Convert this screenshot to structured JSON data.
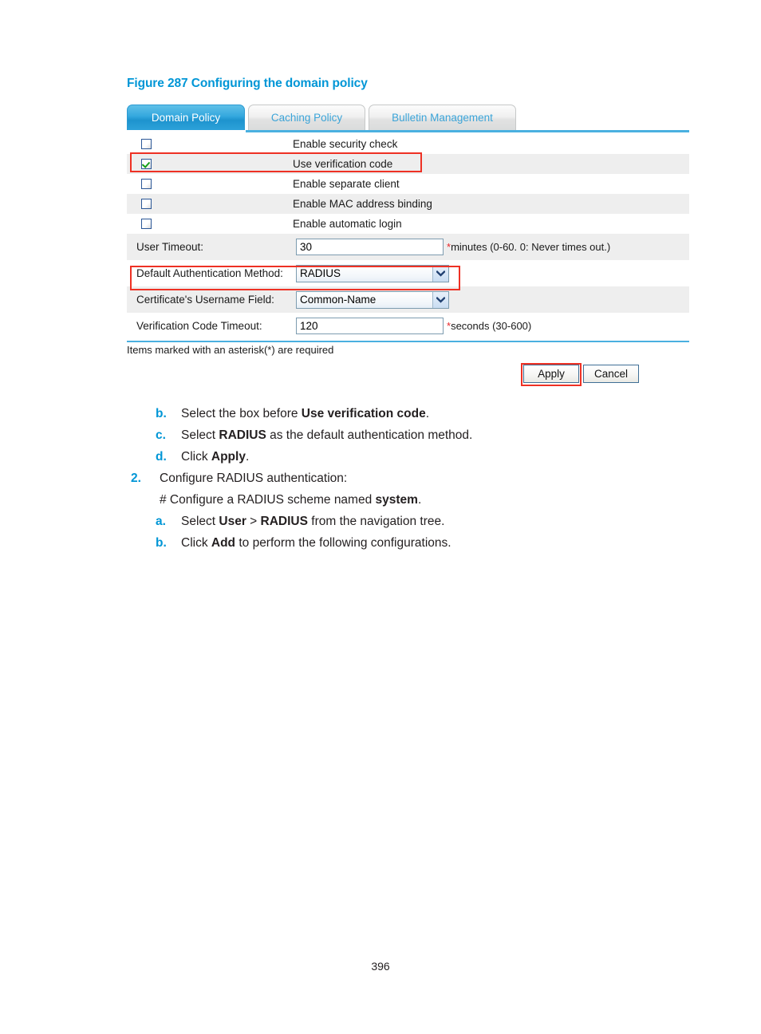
{
  "figure": {
    "caption": "Figure 287 Configuring the domain policy"
  },
  "screenshot": {
    "tabs": [
      {
        "label": "Domain Policy",
        "active": true
      },
      {
        "label": "Caching Policy",
        "active": false
      },
      {
        "label": "Bulletin Management",
        "active": false
      }
    ],
    "checkbox_rows": [
      {
        "label": "Enable security check",
        "checked": false
      },
      {
        "label": "Use verification code",
        "checked": true
      },
      {
        "label": "Enable separate client",
        "checked": false
      },
      {
        "label": "Enable MAC address binding",
        "checked": false
      },
      {
        "label": "Enable automatic login",
        "checked": false
      }
    ],
    "fields": {
      "user_timeout": {
        "label": "User Timeout:",
        "value": "30",
        "star": "*",
        "hint": "minutes (0-60. 0: Never times out.)"
      },
      "default_auth_method": {
        "label": "Default Authentication Method:",
        "value": "RADIUS"
      },
      "certificate_username_field": {
        "label": "Certificate's Username Field:",
        "value": "Common-Name"
      },
      "verification_code_timeout": {
        "label": "Verification Code Timeout:",
        "value": "120",
        "star": "*",
        "hint": "seconds (30-600)"
      }
    },
    "required_note": "Items marked with an asterisk(*) are required",
    "buttons": {
      "apply": "Apply",
      "cancel": "Cancel"
    },
    "accent_color": "#4ab0e0",
    "highlight_color": "#ee3124"
  },
  "steps": [
    {
      "marker": "b.",
      "marker_kind": "alpha",
      "parts": [
        {
          "t": "Select the box before ",
          "b": false
        },
        {
          "t": "Use verification code",
          "b": true
        },
        {
          "t": ".",
          "b": false
        }
      ]
    },
    {
      "marker": "c.",
      "marker_kind": "alpha",
      "parts": [
        {
          "t": "Select ",
          "b": false
        },
        {
          "t": "RADIUS",
          "b": true
        },
        {
          "t": " as the default authentication method.",
          "b": false
        }
      ]
    },
    {
      "marker": "d.",
      "marker_kind": "alpha",
      "parts": [
        {
          "t": "Click ",
          "b": false
        },
        {
          "t": "Apply",
          "b": true
        },
        {
          "t": ".",
          "b": false
        }
      ]
    },
    {
      "marker": "2.",
      "marker_kind": "num",
      "parts": [
        {
          "t": "Configure RADIUS authentication:",
          "b": false
        }
      ]
    },
    {
      "marker": "",
      "marker_kind": "none",
      "parts": [
        {
          "t": "# Configure a RADIUS scheme named ",
          "b": false
        },
        {
          "t": "system",
          "b": true
        },
        {
          "t": ".",
          "b": false
        }
      ]
    },
    {
      "marker": "a.",
      "marker_kind": "alpha",
      "parts": [
        {
          "t": "Select ",
          "b": false
        },
        {
          "t": "User",
          "b": true
        },
        {
          "t": " > ",
          "b": false
        },
        {
          "t": "RADIUS",
          "b": true
        },
        {
          "t": " from the navigation tree.",
          "b": false
        }
      ]
    },
    {
      "marker": "b.",
      "marker_kind": "alpha",
      "parts": [
        {
          "t": "Click ",
          "b": false
        },
        {
          "t": "Add",
          "b": true
        },
        {
          "t": " to perform the following configurations.",
          "b": false
        }
      ]
    }
  ],
  "page_number": "396"
}
